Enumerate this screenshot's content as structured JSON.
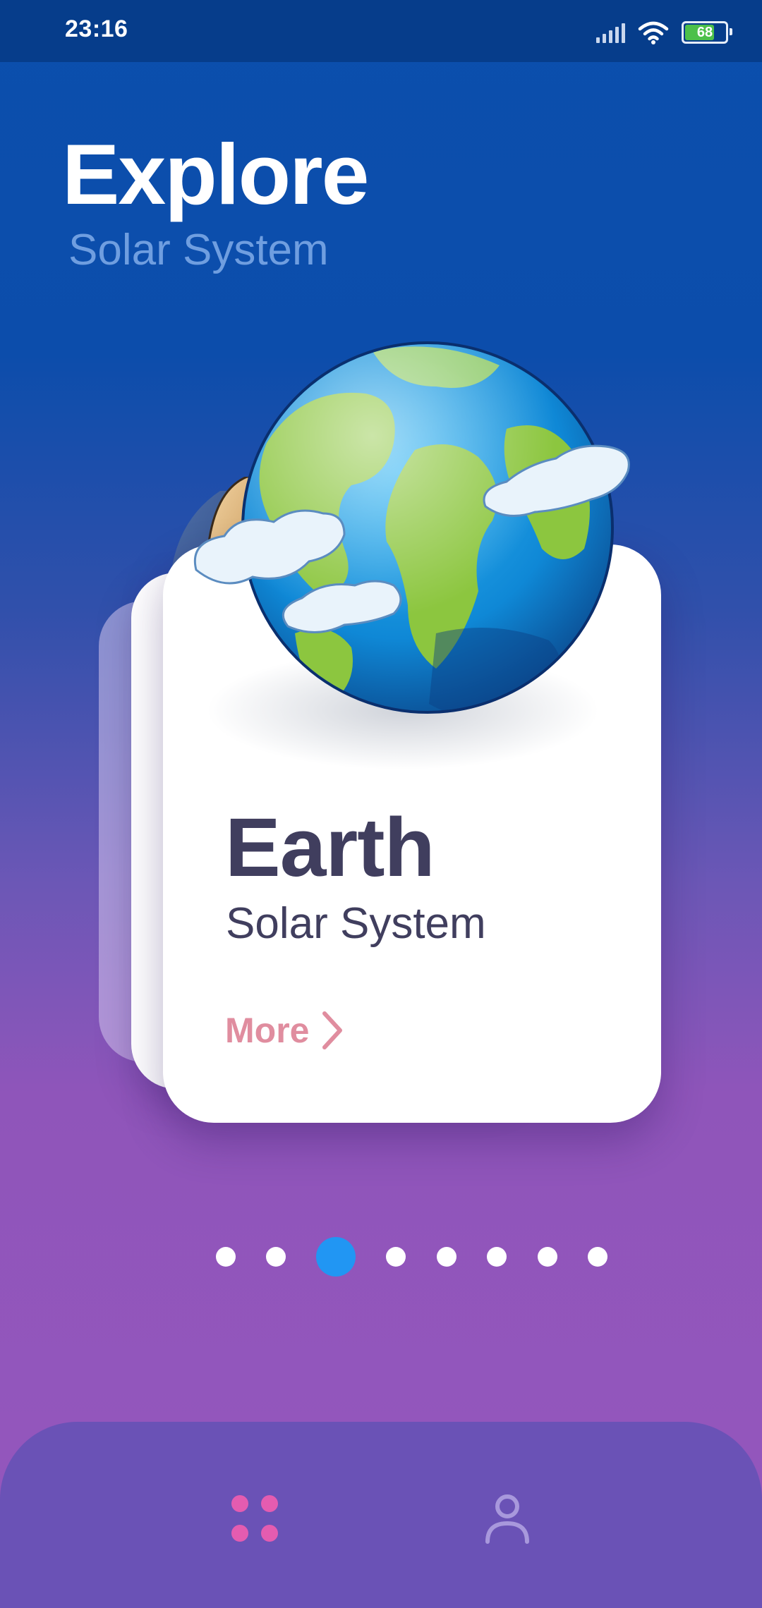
{
  "status_bar": {
    "time": "23:16",
    "battery_level": "68",
    "icons": [
      "signal-icon",
      "wifi-icon",
      "battery-icon"
    ]
  },
  "header": {
    "title": "Explore",
    "subtitle": "Solar System"
  },
  "card": {
    "title": "Earth",
    "subtitle": "Solar System",
    "more_label": "More",
    "image": "earth-planet-illustration"
  },
  "pagination": {
    "count": 8,
    "active_index": 2
  },
  "bottom_nav": {
    "items": [
      {
        "name": "home",
        "icon": "grid-dots-icon",
        "active": true
      },
      {
        "name": "profile",
        "icon": "user-icon",
        "active": false
      }
    ]
  },
  "colors": {
    "accent": "#2196f3",
    "more_link": "#e08d9f",
    "card_text": "#403e5e",
    "nav_bar": "#6a52b6",
    "nav_active_icon": "#e45cb0"
  }
}
